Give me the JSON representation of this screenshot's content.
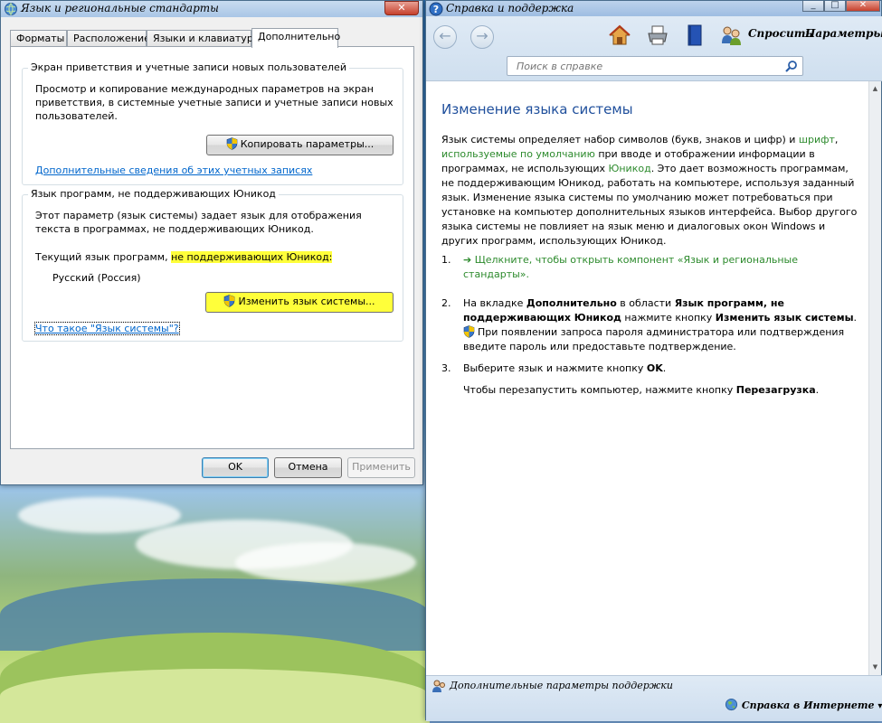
{
  "region": {
    "title": "Язык и региональные стандарты",
    "close_glyph": "✕",
    "tabs": [
      {
        "label": "Форматы"
      },
      {
        "label": "Расположение"
      },
      {
        "label": "Языки и клавиатуры"
      },
      {
        "label": "Дополнительно"
      }
    ],
    "welcome_group": {
      "title": "Экран приветствия и учетные записи новых пользователей",
      "description": "Просмотр и копирование международных параметров на экран приветствия, в системные учетные записи и учетные записи новых пользователей.",
      "copy_button": "Копировать параметры...",
      "link": "Дополнительные сведения об этих учетных записях"
    },
    "unicode_group": {
      "title": "Язык программ, не поддерживающих Юникод",
      "description": "Этот параметр (язык системы) задает язык для отображения текста в программах, не поддерживающих Юникод.",
      "current_label_plain": "Текущий язык программ, ",
      "current_label_highlighted": "не поддерживающих Юникод:",
      "current_value": "Русский (Россия)",
      "change_button": "Изменить язык системы...",
      "link": "Что такое \"Язык системы\"?"
    },
    "buttons": {
      "ok": "OK",
      "cancel": "Отмена",
      "apply": "Применить"
    }
  },
  "help": {
    "title": "Справка и поддержка",
    "controls": {
      "minimize": "_",
      "maximize": "□",
      "close": "✕"
    },
    "toolbar": {
      "back_glyph": "←",
      "forward_glyph": "→",
      "ask_label": "Спросить",
      "options_label": "Параметры",
      "options_arrow": "▾"
    },
    "search": {
      "placeholder": "Поиск в справке"
    },
    "article": {
      "heading": "Изменение языка системы",
      "p_1": "Язык системы определяет набор символов (букв, знаков и цифр) и ",
      "p_link_1": "шрифт",
      "p_2": ", ",
      "p_link_2": "используемые по умолчанию",
      "p_3": " при вводе и отображении информации в программах, не использующих ",
      "p_link_3": "Юникод",
      "p_4": ". Это дает возможность программам, не поддерживающим Юникод, работать на компьютере, используя заданный язык. Изменение языка системы по умолчанию может потребоваться при установке на компьютер дополнительных языков интерфейса. Выбор другого языка системы не повлияет на язык меню и диалоговых окон Windows и других программ, использующих Юникод.",
      "steps": {
        "s1_num": "1.",
        "s1_arrow": "➔",
        "s1_link": "Щелкните, чтобы открыть компонент «Язык и региональные стандарты».",
        "s2_num": "2.",
        "s2_a": "На вкладке ",
        "s2_b": "Дополнительно",
        "s2_c": " в области ",
        "s2_d": "Язык программ, не поддерживающих Юникод",
        "s2_e": " нажмите кнопку ",
        "s2_f": "Изменить язык системы",
        "s2_g": ".",
        "s2_h": "При появлении запроса пароля администратора или подтверждения введите пароль или предоставьте подтверждение.",
        "s3_num": "3.",
        "s3_a": "Выберите язык и нажмите кнопку ",
        "s3_b": "OK",
        "s3_c": ".",
        "s3_d": "Чтобы перезапустить компьютер, нажмите кнопку ",
        "s3_e": "Перезагрузка",
        "s3_f": "."
      }
    },
    "status": {
      "support_label": "Дополнительные параметры поддержки",
      "online_label": "Справка в Интернете",
      "online_arrow": "▾"
    }
  },
  "colors": {
    "highlight": "#ffff3a",
    "link": "#0066cc",
    "heading": "#1f4f9c",
    "help_link": "#2c8a2c"
  }
}
